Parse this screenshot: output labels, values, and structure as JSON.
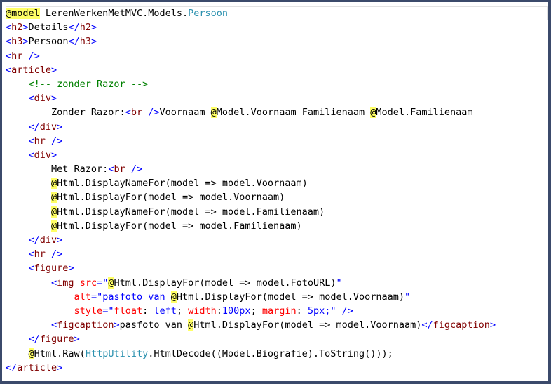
{
  "editor": {
    "lines": [
      {
        "indent": 0,
        "current": true,
        "tokens": [
          {
            "t": "@",
            "c": "hl"
          },
          {
            "t": "model",
            "c": "hl"
          },
          {
            "t": " LerenWerkenMetMVC.Models.",
            "c": ""
          },
          {
            "t": "Persoon",
            "c": "type"
          }
        ]
      },
      {
        "indent": 0,
        "tokens": [
          {
            "t": "<",
            "c": "tag"
          },
          {
            "t": "h2",
            "c": "tagname"
          },
          {
            "t": ">",
            "c": "tag"
          },
          {
            "t": "Details",
            "c": ""
          },
          {
            "t": "</",
            "c": "tag"
          },
          {
            "t": "h2",
            "c": "tagname"
          },
          {
            "t": ">",
            "c": "tag"
          }
        ]
      },
      {
        "indent": 0,
        "tokens": [
          {
            "t": "<",
            "c": "tag"
          },
          {
            "t": "h3",
            "c": "tagname"
          },
          {
            "t": ">",
            "c": "tag"
          },
          {
            "t": "Persoon",
            "c": ""
          },
          {
            "t": "</",
            "c": "tag"
          },
          {
            "t": "h3",
            "c": "tagname"
          },
          {
            "t": ">",
            "c": "tag"
          }
        ]
      },
      {
        "indent": 0,
        "tokens": [
          {
            "t": "<",
            "c": "tag"
          },
          {
            "t": "hr",
            "c": "tagname"
          },
          {
            "t": " />",
            "c": "tag"
          }
        ]
      },
      {
        "indent": 0,
        "tokens": [
          {
            "t": "<",
            "c": "tag"
          },
          {
            "t": "article",
            "c": "tagname"
          },
          {
            "t": ">",
            "c": "tag"
          }
        ]
      },
      {
        "indent": 1,
        "tokens": [
          {
            "t": "<!-- zonder Razor -->",
            "c": "cmt"
          }
        ]
      },
      {
        "indent": 1,
        "tokens": [
          {
            "t": "<",
            "c": "tag"
          },
          {
            "t": "div",
            "c": "tagname"
          },
          {
            "t": ">",
            "c": "tag"
          }
        ]
      },
      {
        "indent": 2,
        "tokens": [
          {
            "t": "Zonder Razor:",
            "c": ""
          },
          {
            "t": "<",
            "c": "tag"
          },
          {
            "t": "br",
            "c": "tagname"
          },
          {
            "t": " />",
            "c": "tag"
          },
          {
            "t": "Voornaam ",
            "c": ""
          },
          {
            "t": "@",
            "c": "hl"
          },
          {
            "t": "Model.Voornaam Familienaam ",
            "c": ""
          },
          {
            "t": "@",
            "c": "hl"
          },
          {
            "t": "Model.Familienaam",
            "c": ""
          }
        ]
      },
      {
        "indent": 1,
        "tokens": [
          {
            "t": "</",
            "c": "tag"
          },
          {
            "t": "div",
            "c": "tagname"
          },
          {
            "t": ">",
            "c": "tag"
          }
        ]
      },
      {
        "indent": 1,
        "tokens": [
          {
            "t": "<",
            "c": "tag"
          },
          {
            "t": "hr",
            "c": "tagname"
          },
          {
            "t": " />",
            "c": "tag"
          }
        ]
      },
      {
        "indent": 1,
        "tokens": [
          {
            "t": "<",
            "c": "tag"
          },
          {
            "t": "div",
            "c": "tagname"
          },
          {
            "t": ">",
            "c": "tag"
          }
        ]
      },
      {
        "indent": 2,
        "tokens": [
          {
            "t": "Met Razor:",
            "c": ""
          },
          {
            "t": "<",
            "c": "tag"
          },
          {
            "t": "br",
            "c": "tagname"
          },
          {
            "t": " />",
            "c": "tag"
          }
        ]
      },
      {
        "indent": 2,
        "tokens": [
          {
            "t": "@",
            "c": "hl"
          },
          {
            "t": "Html.DisplayNameFor(model => model.Voornaam)",
            "c": ""
          }
        ]
      },
      {
        "indent": 2,
        "tokens": [
          {
            "t": "@",
            "c": "hl"
          },
          {
            "t": "Html.DisplayFor(model => model.Voornaam)",
            "c": ""
          }
        ]
      },
      {
        "indent": 2,
        "tokens": [
          {
            "t": "@",
            "c": "hl"
          },
          {
            "t": "Html.DisplayNameFor(model => model.Familienaam)",
            "c": ""
          }
        ]
      },
      {
        "indent": 2,
        "tokens": [
          {
            "t": "@",
            "c": "hl"
          },
          {
            "t": "Html.DisplayFor(model => model.Familienaam)",
            "c": ""
          }
        ]
      },
      {
        "indent": 1,
        "tokens": [
          {
            "t": "</",
            "c": "tag"
          },
          {
            "t": "div",
            "c": "tagname"
          },
          {
            "t": ">",
            "c": "tag"
          }
        ]
      },
      {
        "indent": 1,
        "tokens": [
          {
            "t": "<",
            "c": "tag"
          },
          {
            "t": "hr",
            "c": "tagname"
          },
          {
            "t": " />",
            "c": "tag"
          }
        ]
      },
      {
        "indent": 1,
        "tokens": [
          {
            "t": "<",
            "c": "tag"
          },
          {
            "t": "figure",
            "c": "tagname"
          },
          {
            "t": ">",
            "c": "tag"
          }
        ]
      },
      {
        "indent": 2,
        "tokens": [
          {
            "t": "<",
            "c": "tag"
          },
          {
            "t": "img",
            "c": "tagname"
          },
          {
            "t": " ",
            "c": ""
          },
          {
            "t": "src",
            "c": "attr"
          },
          {
            "t": "=\"",
            "c": "val"
          },
          {
            "t": "@",
            "c": "hl"
          },
          {
            "t": "Html.DisplayFor(model => model.FotoURL)",
            "c": ""
          },
          {
            "t": "\"",
            "c": "val"
          }
        ]
      },
      {
        "indent": 3,
        "tokens": [
          {
            "t": "alt",
            "c": "attr"
          },
          {
            "t": "=\"pasfoto van ",
            "c": "val"
          },
          {
            "t": "@",
            "c": "hl"
          },
          {
            "t": "Html.DisplayFor(model => model.Voornaam)",
            "c": ""
          },
          {
            "t": "\"",
            "c": "val"
          }
        ]
      },
      {
        "indent": 3,
        "tokens": [
          {
            "t": "style",
            "c": "attr"
          },
          {
            "t": "=\"",
            "c": "val"
          },
          {
            "t": "float",
            "c": "attr"
          },
          {
            "t": ": ",
            "c": ""
          },
          {
            "t": "left",
            "c": "val"
          },
          {
            "t": "; ",
            "c": ""
          },
          {
            "t": "width",
            "c": "attr"
          },
          {
            "t": ":",
            "c": ""
          },
          {
            "t": "100px",
            "c": "val"
          },
          {
            "t": "; ",
            "c": ""
          },
          {
            "t": "margin",
            "c": "attr"
          },
          {
            "t": ": ",
            "c": ""
          },
          {
            "t": "5px",
            "c": "val"
          },
          {
            "t": ";\"",
            "c": "val"
          },
          {
            "t": " />",
            "c": "tag"
          }
        ]
      },
      {
        "indent": 2,
        "tokens": [
          {
            "t": "<",
            "c": "tag"
          },
          {
            "t": "figcaption",
            "c": "tagname"
          },
          {
            "t": ">",
            "c": "tag"
          },
          {
            "t": "pasfoto van ",
            "c": ""
          },
          {
            "t": "@",
            "c": "hl"
          },
          {
            "t": "Html.DisplayFor(model => model.Voornaam)",
            "c": ""
          },
          {
            "t": "</",
            "c": "tag"
          },
          {
            "t": "figcaption",
            "c": "tagname"
          },
          {
            "t": ">",
            "c": "tag"
          }
        ]
      },
      {
        "indent": 1,
        "tokens": [
          {
            "t": "</",
            "c": "tag"
          },
          {
            "t": "figure",
            "c": "tagname"
          },
          {
            "t": ">",
            "c": "tag"
          }
        ]
      },
      {
        "indent": 1,
        "tokens": [
          {
            "t": "@",
            "c": "hl"
          },
          {
            "t": "Html.Raw(",
            "c": ""
          },
          {
            "t": "HttpUtility",
            "c": "type"
          },
          {
            "t": ".HtmlDecode((Model.Biografie).ToString()));",
            "c": ""
          }
        ]
      },
      {
        "indent": 0,
        "tokens": [
          {
            "t": "</",
            "c": "tag"
          },
          {
            "t": "article",
            "c": "tagname"
          },
          {
            "t": ">",
            "c": "tag"
          }
        ]
      }
    ]
  }
}
